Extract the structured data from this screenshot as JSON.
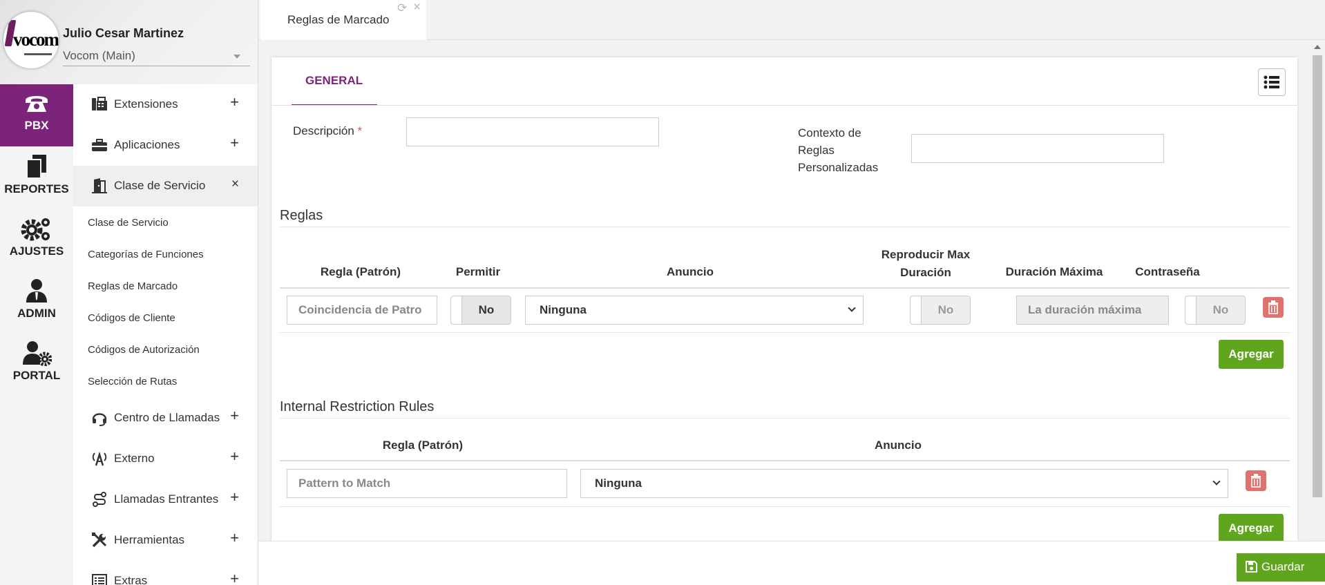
{
  "user": {
    "name": "Julio Cesar Martinez",
    "domain": "Vocom (Main)",
    "logo_text": "vocom"
  },
  "main_nav": [
    {
      "label": "PBX",
      "icon": "phone-icon",
      "active": true
    },
    {
      "label": "REPORTES",
      "icon": "documents-icon",
      "active": false
    },
    {
      "label": "AJUSTES",
      "icon": "gears-icon",
      "active": false
    },
    {
      "label": "ADMIN",
      "icon": "admin-user-icon",
      "active": false
    },
    {
      "label": "PORTAL",
      "icon": "user-gear-icon",
      "active": false
    }
  ],
  "submenu": {
    "sections": [
      {
        "label": "Extensiones",
        "icon": "fax-phone-icon",
        "toggle": "+"
      },
      {
        "label": "Aplicaciones",
        "icon": "toolbox-icon",
        "toggle": "+"
      },
      {
        "label": "Clase de Servicio",
        "icon": "door-icon",
        "toggle": "×"
      },
      {
        "label": "Centro de Llamadas",
        "icon": "headset-icon",
        "toggle": "+"
      },
      {
        "label": "Externo",
        "icon": "antenna-icon",
        "toggle": "+"
      },
      {
        "label": "Llamadas Entrantes",
        "icon": "route-icon",
        "toggle": "+"
      },
      {
        "label": "Herramientas",
        "icon": "tools-icon",
        "toggle": "+"
      },
      {
        "label": "Extras",
        "icon": "list-icon",
        "toggle": "+"
      }
    ],
    "open_items": [
      "Clase de Servicio",
      "Categorías de Funciones",
      "Reglas de Marcado",
      "Códigos de Cliente",
      "Códigos de Autorización",
      "Selección de Rutas"
    ]
  },
  "tab": {
    "title": "Reglas de Marcado"
  },
  "content": {
    "tab_general": "GENERAL",
    "descripcion_label": "Descripción",
    "descripcion_required": "*",
    "descripcion_value": "",
    "contexto_label_1": "Contexto de",
    "contexto_label_2": "Reglas",
    "contexto_label_3": "Personalizadas",
    "contexto_value": ""
  },
  "reglas": {
    "title": "Reglas",
    "headers": {
      "regla": "Regla (Patrón)",
      "permitir": "Permitir",
      "anuncio": "Anuncio",
      "reproducir_1": "Reproducir Max",
      "reproducir_2": "Duración",
      "duracion": "Duración Máxima",
      "contrasena": "Contraseña"
    },
    "row": {
      "pattern_placeholder": "Coincidencia de Patro",
      "permitir": "No",
      "anuncio": "Ninguna",
      "reproducir": "No",
      "duracion_placeholder": "La duración máxima",
      "contrasena": "No"
    },
    "add_button": "Agregar"
  },
  "internal": {
    "title": "Internal Restriction Rules",
    "headers": {
      "regla": "Regla (Patrón)",
      "anuncio": "Anuncio"
    },
    "row": {
      "pattern_placeholder": "Pattern to Match",
      "anuncio": "Ninguna"
    },
    "add_button": "Agregar"
  },
  "footer": {
    "save_label": "Guardar"
  },
  "colors": {
    "brand_purple": "#7b2479",
    "green": "#5fa51d",
    "danger": "#d9534f"
  }
}
